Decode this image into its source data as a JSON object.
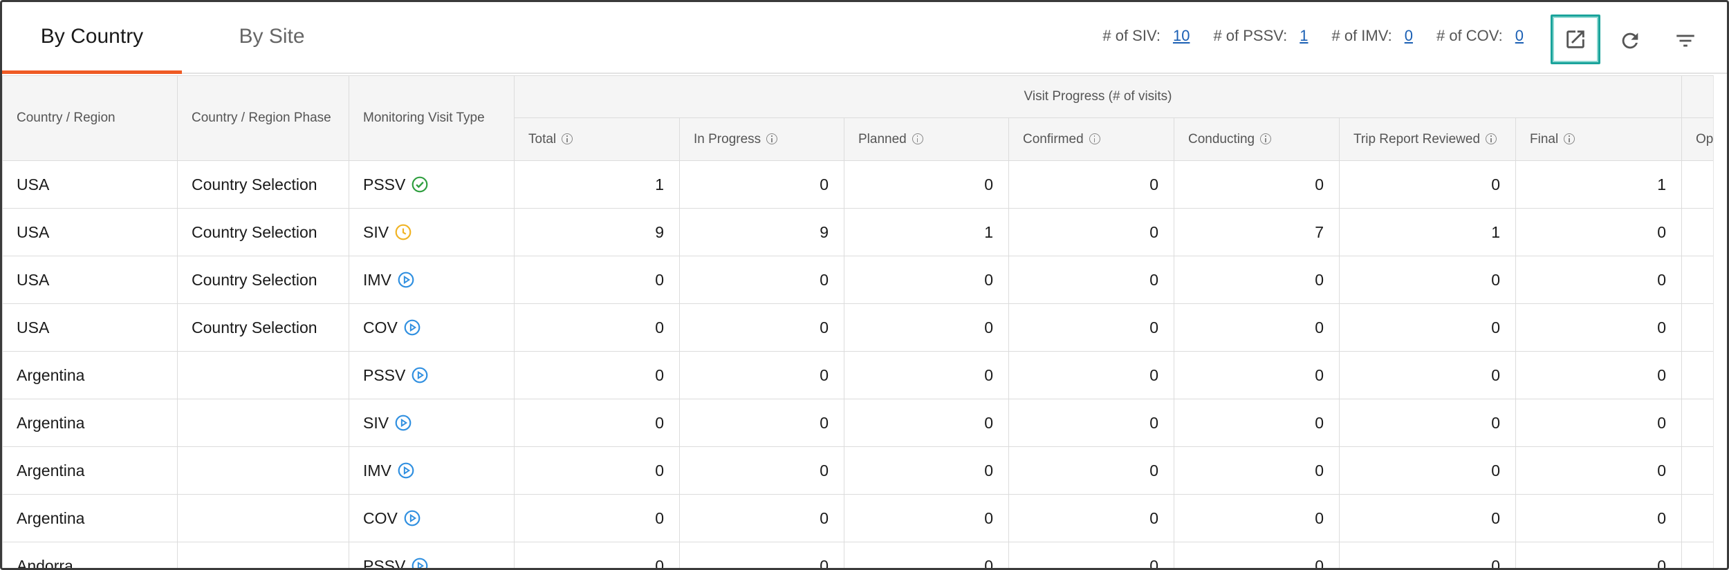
{
  "tabs": [
    {
      "label": "By Country",
      "active": true
    },
    {
      "label": "By Site",
      "active": false
    }
  ],
  "counts": [
    {
      "label": "# of SIV:",
      "value": "10"
    },
    {
      "label": "# of PSSV:",
      "value": "1"
    },
    {
      "label": "# of IMV:",
      "value": "0"
    },
    {
      "label": "# of COV:",
      "value": "0"
    }
  ],
  "toolbar": {
    "open_icon": "open-in-new-icon",
    "refresh_icon": "refresh-icon",
    "filter_icon": "filter-icon",
    "highlight_color": "#1aa39b"
  },
  "table": {
    "group_header": "Visit Progress (# of visits)",
    "fixed_headers": [
      "Country / Region",
      "Country / Region Phase",
      "Monitoring Visit Type"
    ],
    "progress_headers": [
      "Total",
      "In Progress",
      "Planned",
      "Confirmed",
      "Conducting",
      "Trip Report Reviewed",
      "Final",
      "Ope"
    ],
    "rows": [
      {
        "country": "USA",
        "phase": "Country Selection",
        "type": "PSSV",
        "status": "complete",
        "values": [
          "1",
          "0",
          "0",
          "0",
          "0",
          "0",
          "1"
        ]
      },
      {
        "country": "USA",
        "phase": "Country Selection",
        "type": "SIV",
        "status": "pending",
        "values": [
          "9",
          "9",
          "1",
          "0",
          "7",
          "1",
          "0"
        ]
      },
      {
        "country": "USA",
        "phase": "Country Selection",
        "type": "IMV",
        "status": "play",
        "values": [
          "0",
          "0",
          "0",
          "0",
          "0",
          "0",
          "0"
        ]
      },
      {
        "country": "USA",
        "phase": "Country Selection",
        "type": "COV",
        "status": "play",
        "values": [
          "0",
          "0",
          "0",
          "0",
          "0",
          "0",
          "0"
        ]
      },
      {
        "country": "Argentina",
        "phase": "",
        "type": "PSSV",
        "status": "play",
        "values": [
          "0",
          "0",
          "0",
          "0",
          "0",
          "0",
          "0"
        ]
      },
      {
        "country": "Argentina",
        "phase": "",
        "type": "SIV",
        "status": "play",
        "values": [
          "0",
          "0",
          "0",
          "0",
          "0",
          "0",
          "0"
        ]
      },
      {
        "country": "Argentina",
        "phase": "",
        "type": "IMV",
        "status": "play",
        "values": [
          "0",
          "0",
          "0",
          "0",
          "0",
          "0",
          "0"
        ]
      },
      {
        "country": "Argentina",
        "phase": "",
        "type": "COV",
        "status": "play",
        "values": [
          "0",
          "0",
          "0",
          "0",
          "0",
          "0",
          "0"
        ]
      },
      {
        "country": "Andorra",
        "phase": "",
        "type": "PSSV",
        "status": "play",
        "values": [
          "0",
          "0",
          "0",
          "0",
          "0",
          "0",
          "0"
        ]
      }
    ]
  },
  "colors": {
    "accent": "#ef5a24",
    "link": "#1a5fb4",
    "status_complete": "#2e9e3e",
    "status_pending": "#f0b323",
    "status_play": "#2f8fe0"
  }
}
